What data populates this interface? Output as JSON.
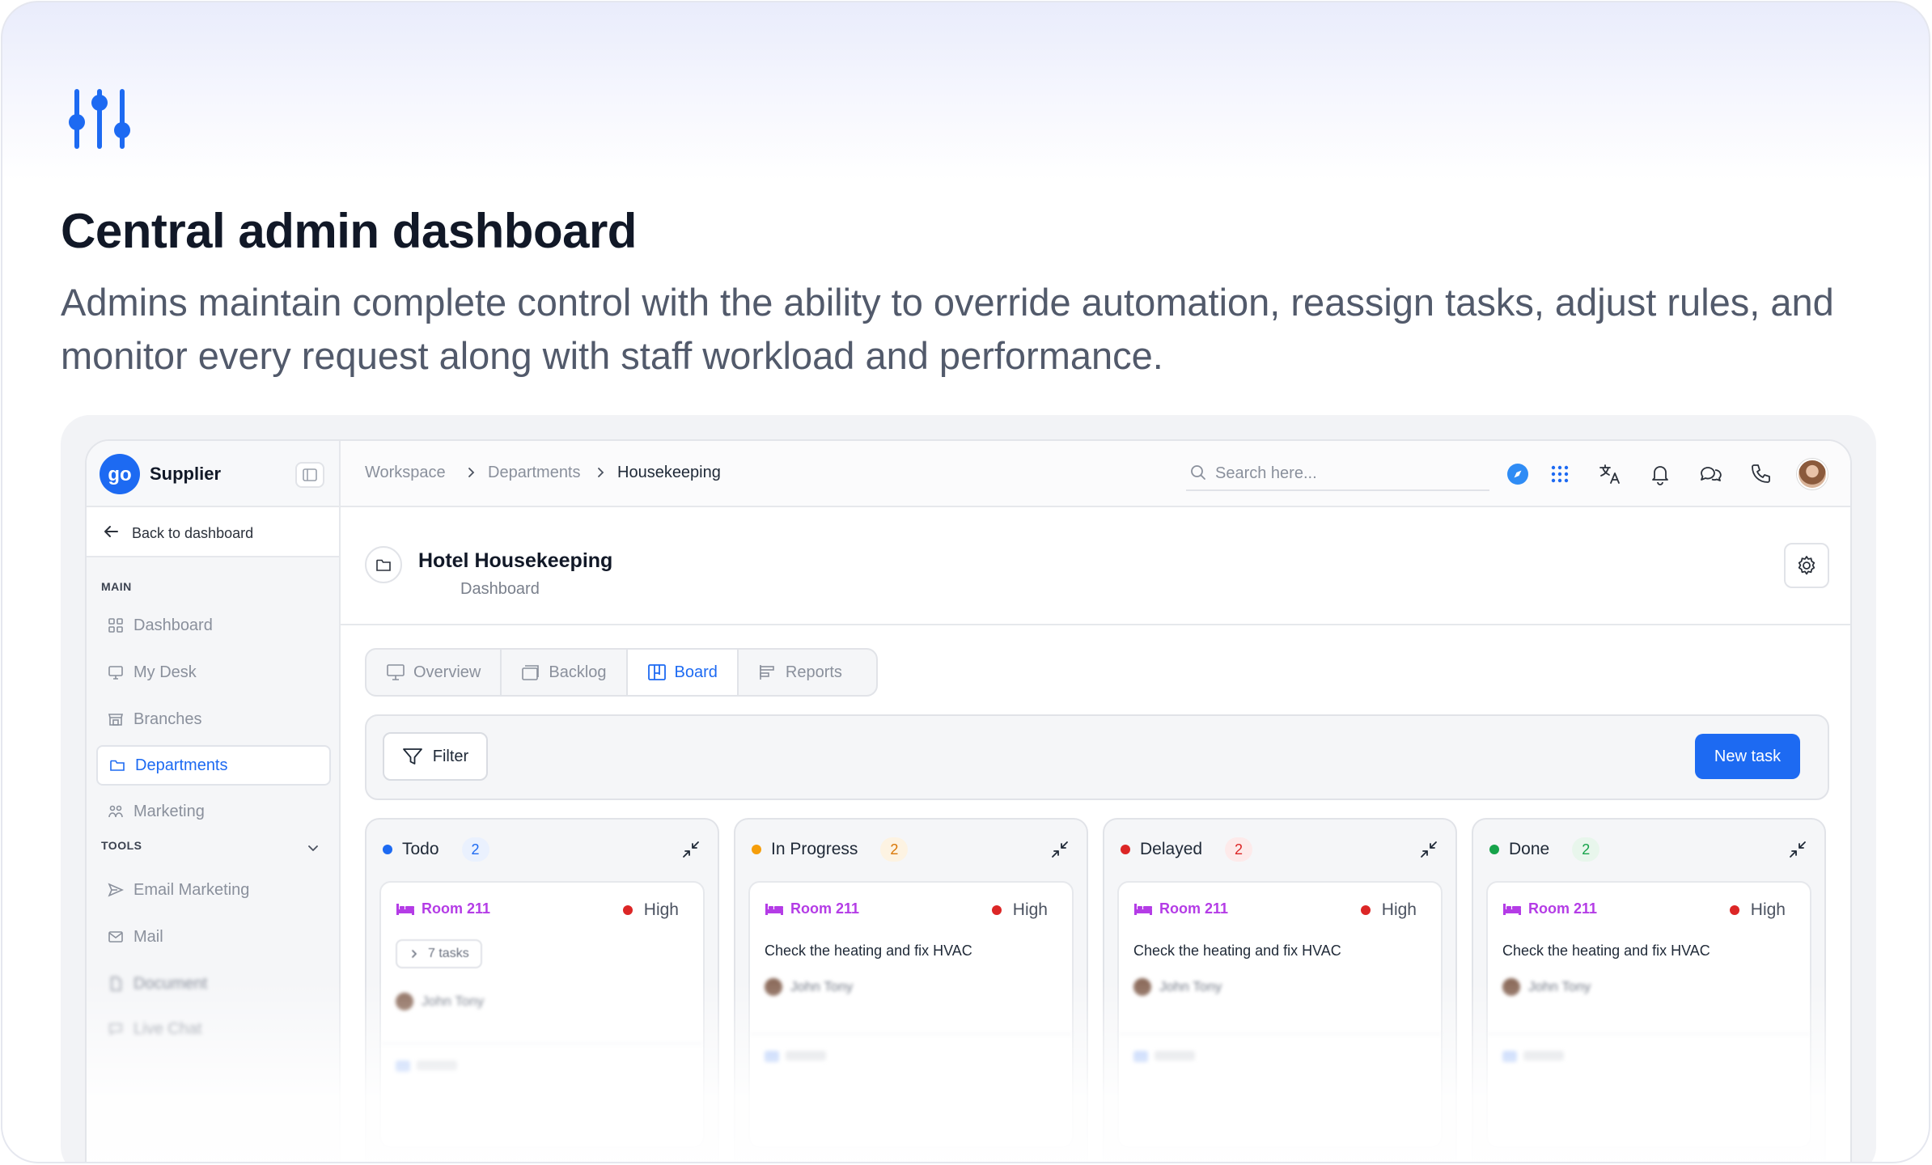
{
  "hero": {
    "title": "Central admin dashboard",
    "description": "Admins maintain complete control with the ability to override automation, reassign tasks, adjust rules, and monitor every request along with staff workload and performance."
  },
  "sidebar": {
    "brand": "Supplier",
    "back_label": "Back to dashboard",
    "main_section": "MAIN",
    "tools_section": "TOOLS",
    "main_items": [
      {
        "label": "Dashboard",
        "icon": "grid-icon"
      },
      {
        "label": "My Desk",
        "icon": "monitor-icon"
      },
      {
        "label": "Branches",
        "icon": "store-icon"
      },
      {
        "label": "Departments",
        "icon": "folder-icon",
        "active": true
      },
      {
        "label": "Marketing",
        "icon": "users-icon"
      }
    ],
    "tool_items": [
      {
        "label": "Email Marketing",
        "icon": "send-icon"
      },
      {
        "label": "Mail",
        "icon": "mail-icon"
      },
      {
        "label": "Document",
        "icon": "document-icon"
      },
      {
        "label": "Live Chat",
        "icon": "chat-icon"
      }
    ]
  },
  "topbar": {
    "breadcrumb": [
      "Workspace",
      "Departments",
      "Housekeeping"
    ],
    "search_placeholder": "Search here..."
  },
  "page": {
    "title": "Hotel Housekeeping",
    "subtitle": "Dashboard"
  },
  "tabs": [
    {
      "label": "Overview",
      "icon": "monitor-icon"
    },
    {
      "label": "Backlog",
      "icon": "stack-icon"
    },
    {
      "label": "Board",
      "icon": "board-icon",
      "active": true
    },
    {
      "label": "Reports",
      "icon": "bars-icon"
    }
  ],
  "toolbar": {
    "filter_label": "Filter",
    "new_task_label": "New task"
  },
  "columns": [
    {
      "name": "Todo",
      "count": "2",
      "dot_color": "#1d6af2",
      "count_bg": "#eaf1fe",
      "count_color": "#1d6af2",
      "card": {
        "room": "Room 211",
        "priority": "High",
        "subtasks": "7 tasks",
        "assignee": "John Tony"
      }
    },
    {
      "name": "In Progress",
      "count": "2",
      "dot_color": "#f59e0b",
      "count_bg": "#fdf3e2",
      "count_color": "#d97706",
      "card": {
        "room": "Room 211",
        "priority": "High",
        "title": "Check the heating and fix HVAC",
        "assignee": "John Tony"
      }
    },
    {
      "name": "Delayed",
      "count": "2",
      "dot_color": "#dc2626",
      "count_bg": "#fdeaea",
      "count_color": "#dc2626",
      "card": {
        "room": "Room 211",
        "priority": "High",
        "title": "Check the heating and fix HVAC",
        "assignee": "John Tony"
      }
    },
    {
      "name": "Done",
      "count": "2",
      "dot_color": "#16a34a",
      "count_bg": "#e8f6ec",
      "count_color": "#16a34a",
      "card": {
        "room": "Room 211",
        "priority": "High",
        "title": "Check the heating and fix HVAC",
        "assignee": "John Tony"
      }
    }
  ],
  "colors": {
    "accent": "#1d6af2",
    "room_label": "#b43ce6",
    "priority_high": "#dc2626"
  }
}
